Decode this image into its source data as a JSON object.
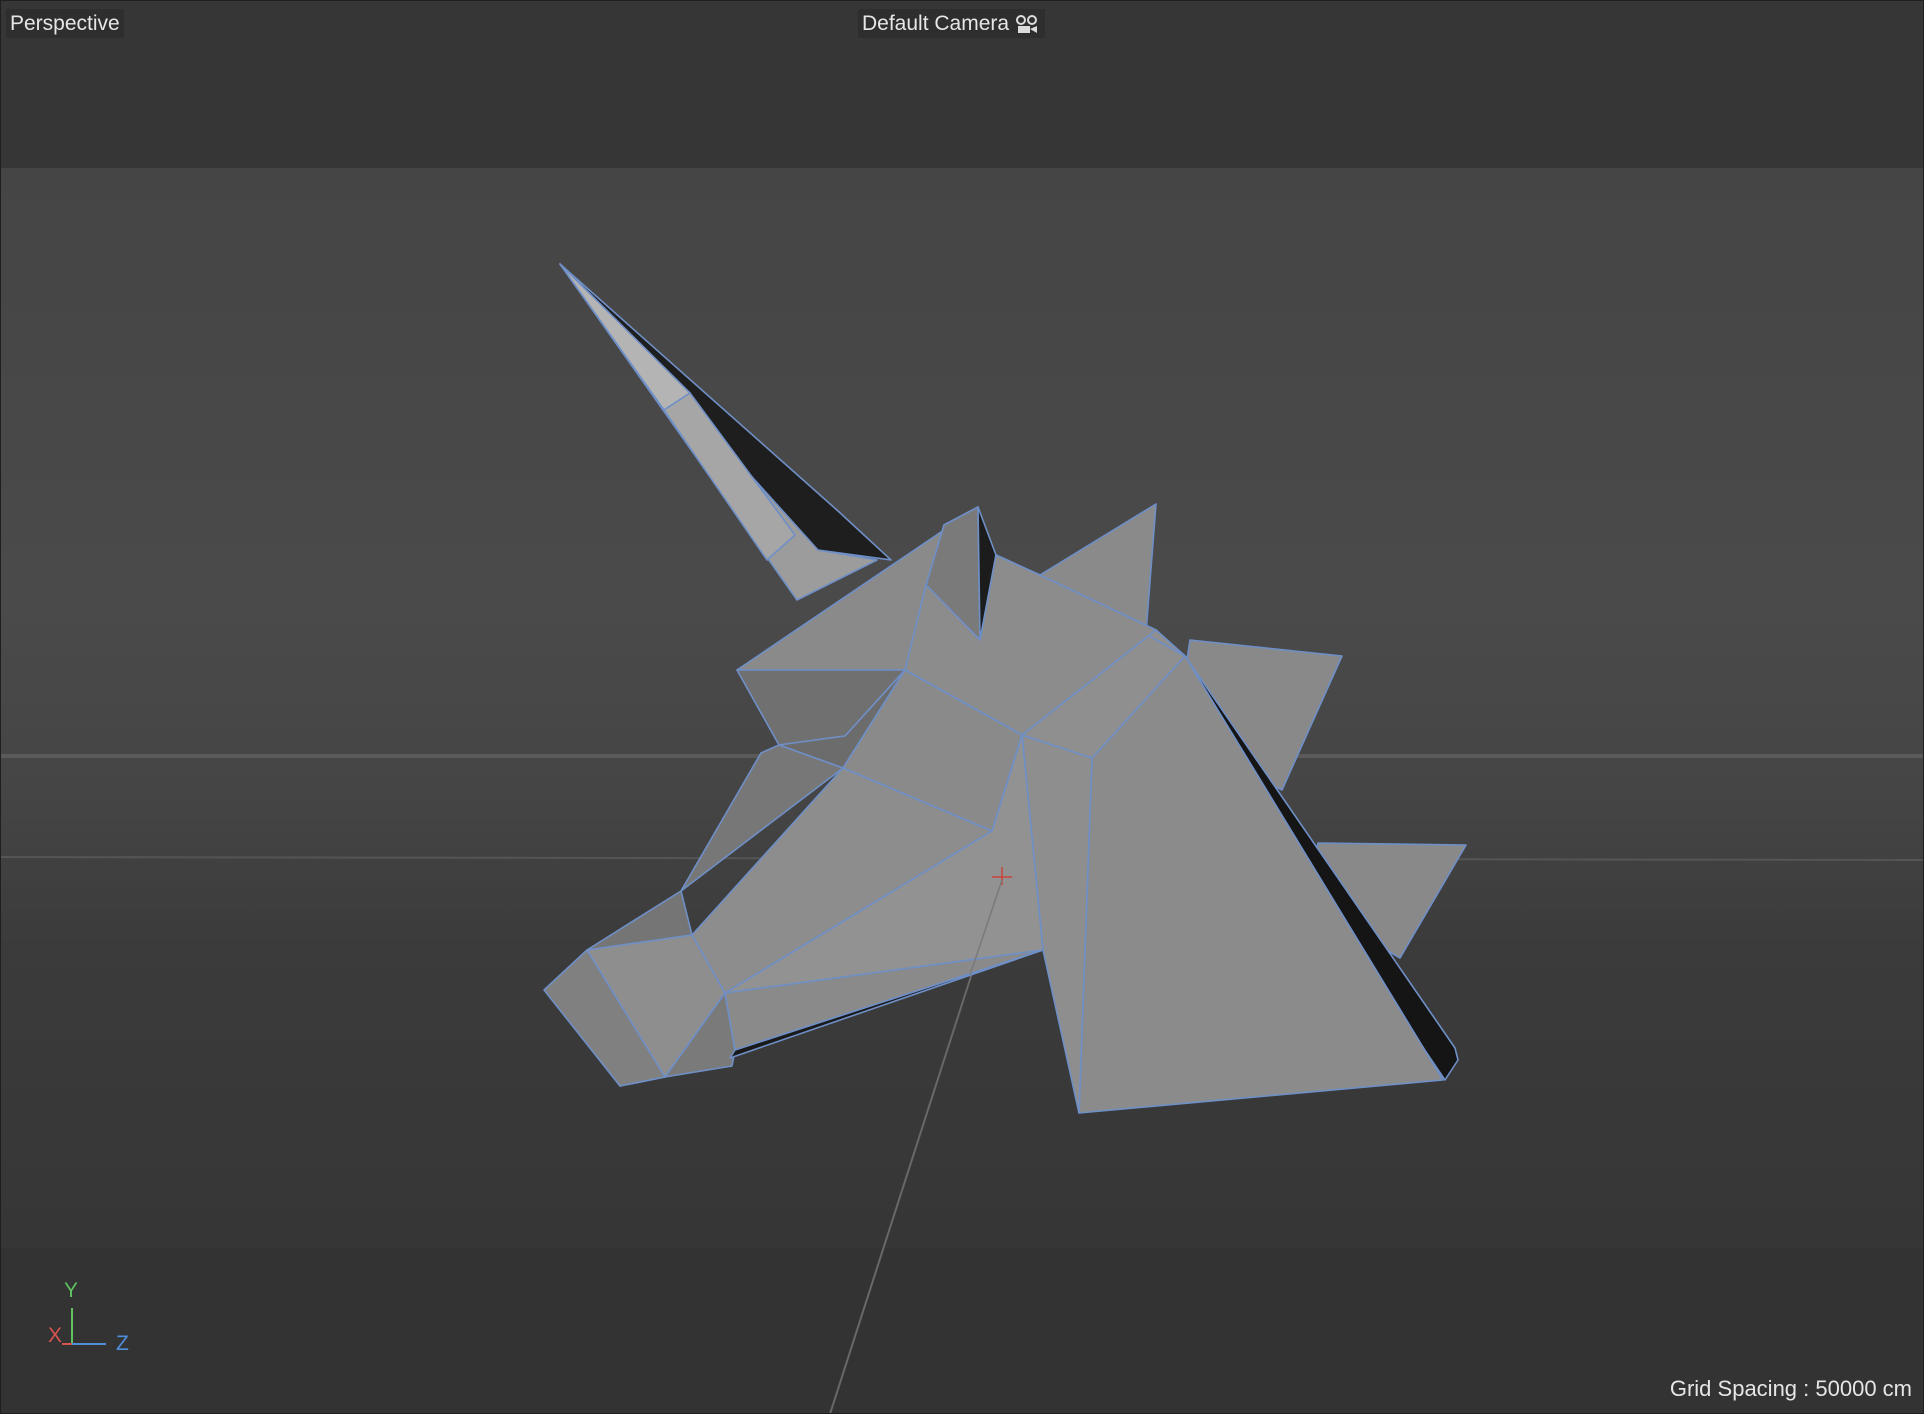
{
  "viewport": {
    "view_name": "Perspective",
    "camera_name": "Default Camera",
    "camera_icon": "camera-glasses-icon",
    "grid_spacing_label": "Grid Spacing : 50000 cm"
  },
  "axis_gizmo": {
    "y": "Y",
    "x": "X",
    "z": "Z"
  },
  "colors": {
    "wire": "#6f8fc7",
    "axis_x": "#d9534f",
    "axis_y": "#5fc15f",
    "axis_z": "#4f8fd9"
  }
}
